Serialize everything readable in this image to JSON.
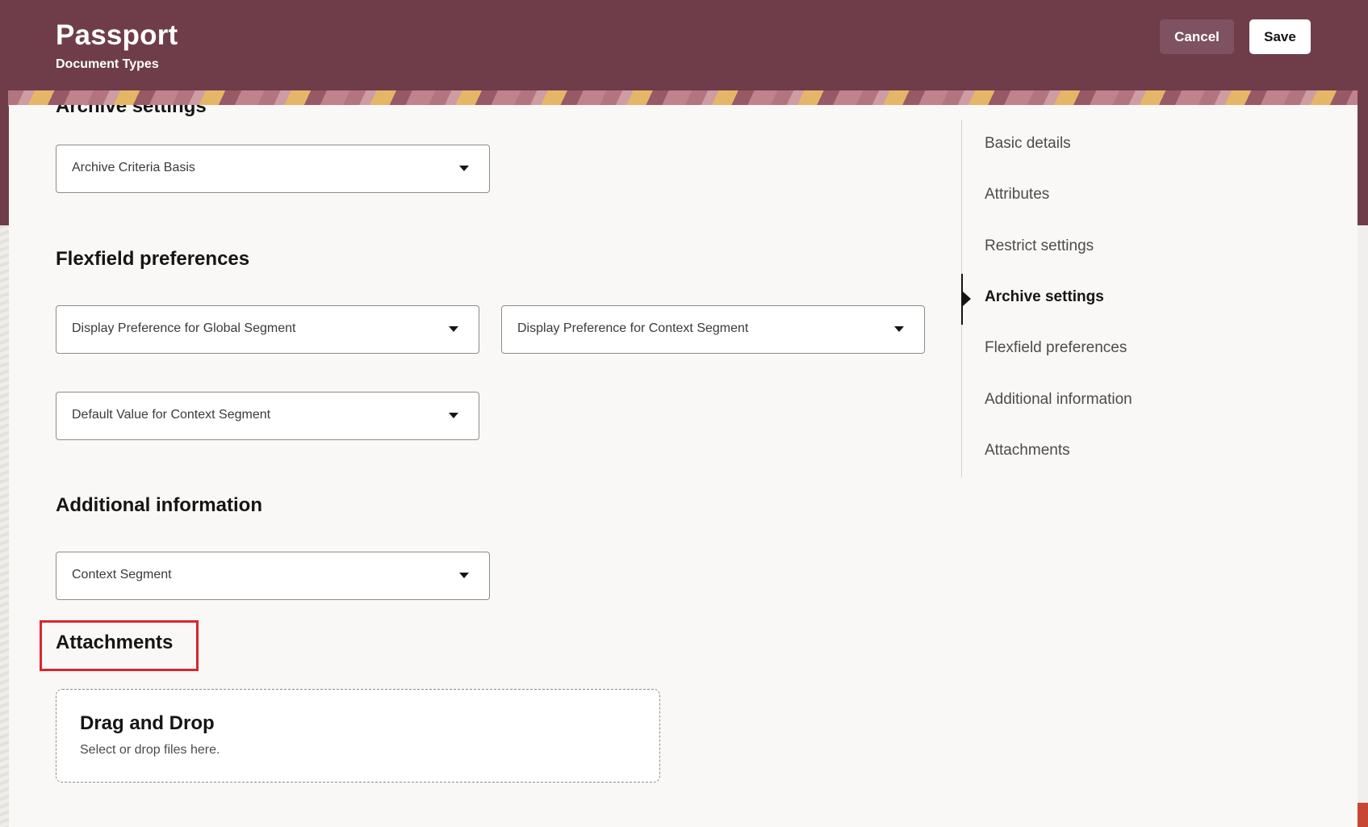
{
  "header": {
    "title": "Passport",
    "subtitle": "Document Types",
    "cancel_label": "Cancel",
    "save_label": "Save",
    "brand_color": "#6f3d4a"
  },
  "sections": {
    "archive": {
      "title": "Archive settings",
      "archive_criteria_basis": "Archive Criteria Basis"
    },
    "flexfield": {
      "title": "Flexfield preferences",
      "global_segment": "Display Preference for Global Segment",
      "context_segment_pref": "Display Preference for Context Segment",
      "default_context_value": "Default Value for Context Segment"
    },
    "additional": {
      "title": "Additional information",
      "context_segment": "Context Segment"
    },
    "attachments": {
      "title": "Attachments",
      "drop_title": "Drag and Drop",
      "drop_subtitle": "Select or drop files here."
    }
  },
  "toc": {
    "items": [
      {
        "label": "Basic details"
      },
      {
        "label": "Attributes"
      },
      {
        "label": "Restrict settings"
      },
      {
        "label": "Archive settings",
        "active": true
      },
      {
        "label": "Flexfield preferences"
      },
      {
        "label": "Additional information"
      },
      {
        "label": "Attachments"
      }
    ]
  },
  "colors": {
    "highlight": "#d9262e",
    "active_marker": "#161513"
  },
  "icons": {
    "dropdown": "caret-down-icon",
    "toc_active": "caret-right-icon"
  }
}
